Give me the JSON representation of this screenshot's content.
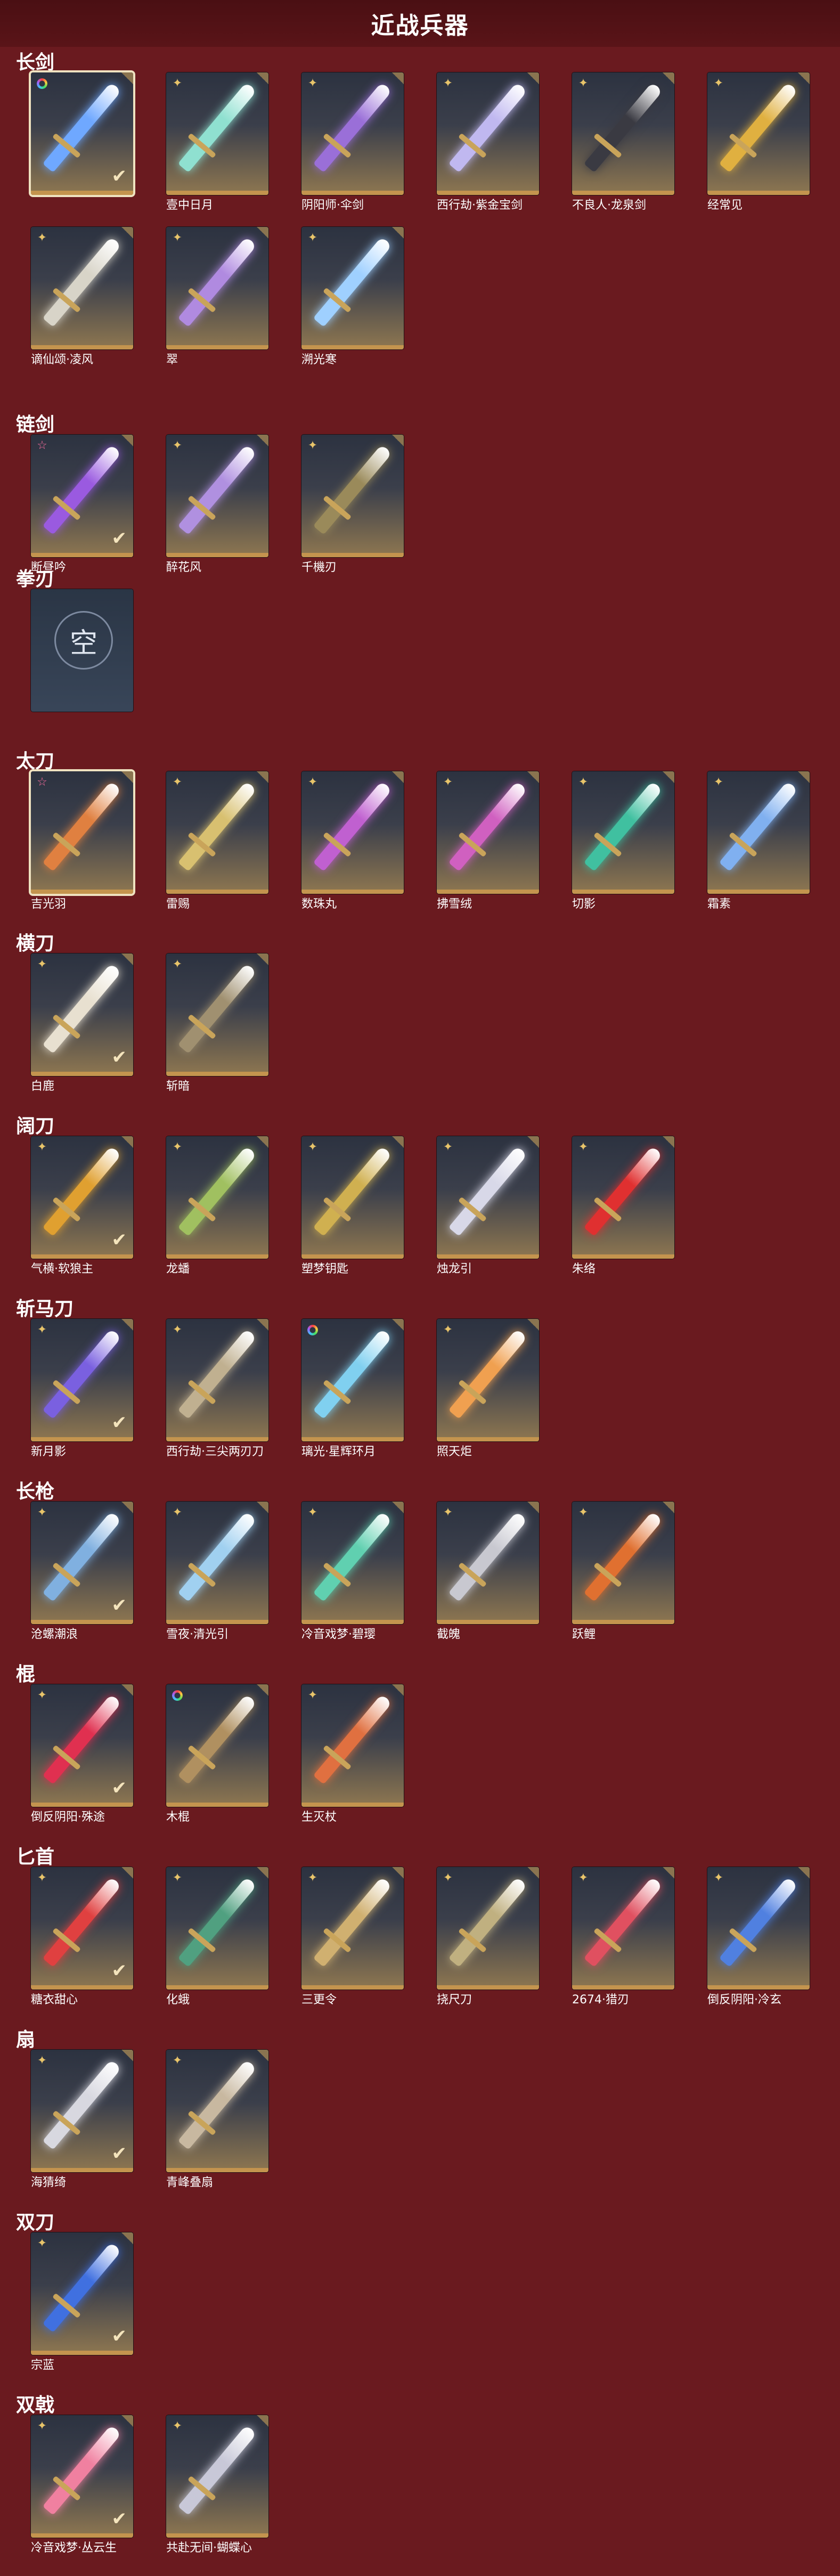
{
  "header": {
    "title": "近战兵器"
  },
  "sections": [
    {
      "title": "长剑",
      "items": [
        {
          "name": "",
          "badge": "rainbow",
          "selected": true,
          "checked": true,
          "color": "#6fa8ff"
        },
        {
          "name": "壹中日月",
          "badge": "gold",
          "color": "#8fe0d0"
        },
        {
          "name": "阴阳师·伞剑",
          "badge": "gold",
          "color": "#9a6fd8"
        },
        {
          "name": "西行劫·紫金宝剑",
          "badge": "gold",
          "color": "#c0b8f0"
        },
        {
          "name": "不良人·龙泉剑",
          "badge": "gold",
          "color": "#3a3a42"
        },
        {
          "name": "经常见",
          "badge": "gold",
          "color": "#e0b040"
        },
        {
          "name": "谪仙颂·凌风",
          "badge": "gold",
          "color": "#d8d4c8"
        },
        {
          "name": "翠",
          "badge": "gold",
          "color": "#b08ae0"
        },
        {
          "name": "溯光寒",
          "badge": "gold",
          "color": "#9fd0ff"
        }
      ]
    },
    {
      "title": "链剑",
      "items": [
        {
          "name": "断昼吟",
          "badge": "pink",
          "checked": true,
          "color": "#9a5ae0"
        },
        {
          "name": "醉花风",
          "badge": "gold",
          "color": "#b090e0"
        },
        {
          "name": "千機刃",
          "badge": "gold",
          "color": "#9a8a5a"
        }
      ]
    },
    {
      "title": "拳刃",
      "items": [
        {
          "name": "",
          "badge": "",
          "empty": true,
          "empty_glyph": "空"
        }
      ]
    },
    {
      "title": "太刀",
      "items": [
        {
          "name": "吉光羽",
          "badge": "pink",
          "selected": true,
          "color": "#e08040"
        },
        {
          "name": "雷赐",
          "badge": "gold",
          "color": "#d8c070"
        },
        {
          "name": "数珠丸",
          "badge": "gold",
          "color": "#c060d0"
        },
        {
          "name": "拂雪绒",
          "badge": "gold",
          "color": "#d060c0"
        },
        {
          "name": "切影",
          "badge": "gold",
          "color": "#40c0a0"
        },
        {
          "name": "霜素",
          "badge": "gold",
          "color": "#80b0f0"
        }
      ]
    },
    {
      "title": "横刀",
      "items": [
        {
          "name": "白鹿",
          "badge": "gold",
          "checked": true,
          "color": "#e8e0d0"
        },
        {
          "name": "斩暗",
          "badge": "gold",
          "color": "#a09070"
        }
      ]
    },
    {
      "title": "阔刀",
      "items": [
        {
          "name": "气横·软狼主",
          "badge": "gold",
          "checked": true,
          "color": "#e0a030"
        },
        {
          "name": "龙蟠",
          "badge": "gold",
          "color": "#a0c060"
        },
        {
          "name": "塑梦钥匙",
          "badge": "gold",
          "color": "#d0b050"
        },
        {
          "name": "烛龙引",
          "badge": "gold",
          "color": "#d8d8e8"
        },
        {
          "name": "朱络",
          "badge": "gold",
          "color": "#e03030"
        }
      ]
    },
    {
      "title": "斩马刀",
      "items": [
        {
          "name": "新月影",
          "badge": "gold",
          "checked": true,
          "color": "#7a60e0"
        },
        {
          "name": "西行劫·三尖两刃刀",
          "badge": "gold",
          "color": "#c0b090"
        },
        {
          "name": "璃光·星辉环月",
          "badge": "rainbow",
          "color": "#80d0f0"
        },
        {
          "name": "照天炬",
          "badge": "gold",
          "color": "#f0a050"
        }
      ]
    },
    {
      "title": "长枪",
      "items": [
        {
          "name": "沧螺潮浪",
          "badge": "gold",
          "checked": true,
          "color": "#80b0e0"
        },
        {
          "name": "雪夜·清光引",
          "badge": "gold",
          "color": "#a0d0f0"
        },
        {
          "name": "冷音戏梦·碧璎",
          "badge": "gold",
          "color": "#60d0b0"
        },
        {
          "name": "截魄",
          "badge": "gold",
          "color": "#c8c8d0"
        },
        {
          "name": "跃鲤",
          "badge": "gold",
          "color": "#e07030"
        }
      ]
    },
    {
      "title": "棍",
      "items": [
        {
          "name": "倒反阴阳·殊途",
          "badge": "gold",
          "checked": true,
          "color": "#e03050"
        },
        {
          "name": "木棍",
          "badge": "rainbow",
          "color": "#b09060"
        },
        {
          "name": "生灭杖",
          "badge": "gold",
          "color": "#e07040"
        }
      ]
    },
    {
      "title": "匕首",
      "items": [
        {
          "name": "糖衣甜心",
          "badge": "gold",
          "checked": true,
          "color": "#e04040"
        },
        {
          "name": "化蛾",
          "badge": "gold",
          "color": "#50a080"
        },
        {
          "name": "三更令",
          "badge": "gold",
          "color": "#d0b070"
        },
        {
          "name": "挠尺刀",
          "badge": "gold",
          "color": "#c0b080"
        },
        {
          "name": "2674·猎刃",
          "badge": "gold",
          "color": "#e05060"
        },
        {
          "name": "倒反阴阳·冷玄",
          "badge": "gold",
          "color": "#5080e0"
        }
      ]
    },
    {
      "title": "扇",
      "items": [
        {
          "name": "海猜绮",
          "badge": "gold",
          "checked": true,
          "color": "#d8d8e0"
        },
        {
          "name": "青峰叠扇",
          "badge": "gold",
          "color": "#c8b8a0"
        }
      ]
    },
    {
      "title": "双刀",
      "items": [
        {
          "name": "宗蓝",
          "badge": "gold",
          "checked": true,
          "color": "#4070e0"
        }
      ]
    },
    {
      "title": "双戟",
      "items": [
        {
          "name": "冷音戏梦·丛云生",
          "badge": "gold",
          "checked": true,
          "color": "#f080a0"
        },
        {
          "name": "共赴无间·蝴蝶心",
          "badge": "gold",
          "color": "#c8c8d8"
        }
      ]
    }
  ],
  "icons": {
    "gold": "four-point-star-icon",
    "pink": "pink-star-icon",
    "rainbow": "rainbow-ring-icon",
    "check": "checkmark-icon"
  }
}
